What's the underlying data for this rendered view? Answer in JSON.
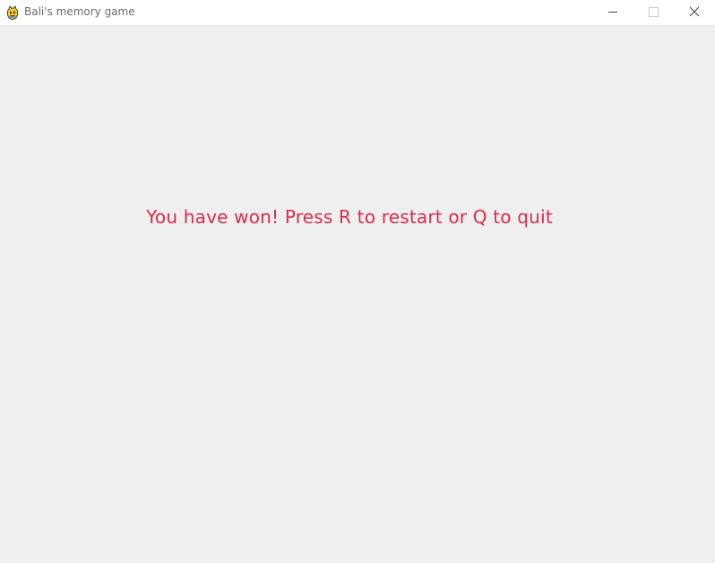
{
  "window": {
    "title": "Bali's memory game",
    "app_icon": "pygame-snake-icon",
    "controls": {
      "minimize_icon": "minimize-icon",
      "maximize_icon": "maximize-icon",
      "close_icon": "close-icon"
    }
  },
  "game": {
    "message": "You have won! Press R to restart or Q to quit",
    "message_color": "#dc2b4a",
    "background_color": "#efefef"
  }
}
